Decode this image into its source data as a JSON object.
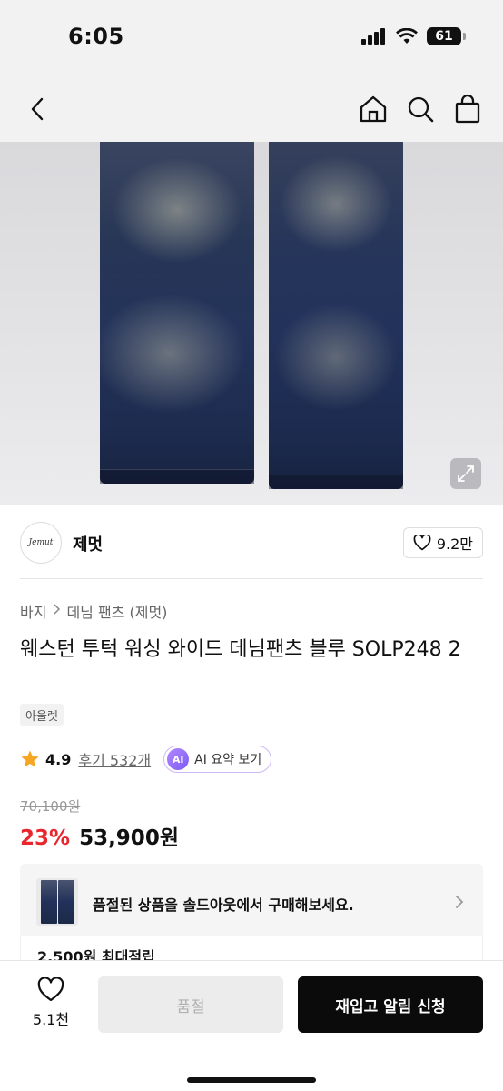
{
  "status_bar": {
    "time": "6:05",
    "battery": "61"
  },
  "store": {
    "logo_text": "Jemut",
    "name": "제멋",
    "favorites": "9.2만"
  },
  "breadcrumb": {
    "category": "바지",
    "subcategory": "데님 팬츠 (제멋)"
  },
  "product": {
    "title": "웨스턴 투턱 워싱 와이드 데님팬츠 블루 SOLP248 2",
    "tag": "아울렛",
    "rating": "4.9",
    "reviews": "후기 532개",
    "ai_badge": "AI",
    "ai_summary": "AI 요약 보기",
    "original_price": "70,100원",
    "discount": "23%",
    "sale_price": "53,900원"
  },
  "soldout_notice": {
    "text": "품절된 상품을 솔드아웃에서 구매해보세요."
  },
  "points": {
    "text": "2,500원 최대적립"
  },
  "bottom_bar": {
    "likes": "5.1천",
    "soldout_label": "품절",
    "restock_label": "재입고 알림 신청"
  },
  "icons": {
    "back": "back-icon",
    "home": "home-icon",
    "search": "search-icon",
    "bag": "shopping-bag-icon",
    "expand": "expand-icon",
    "heart": "heart-icon",
    "star": "star-icon",
    "chevron": "chevron-right-icon"
  },
  "colors": {
    "discount": "#e8262d",
    "primary_button": "#0b0b0b",
    "star": "#f5a623",
    "ai_border": "#cdb8f3"
  }
}
